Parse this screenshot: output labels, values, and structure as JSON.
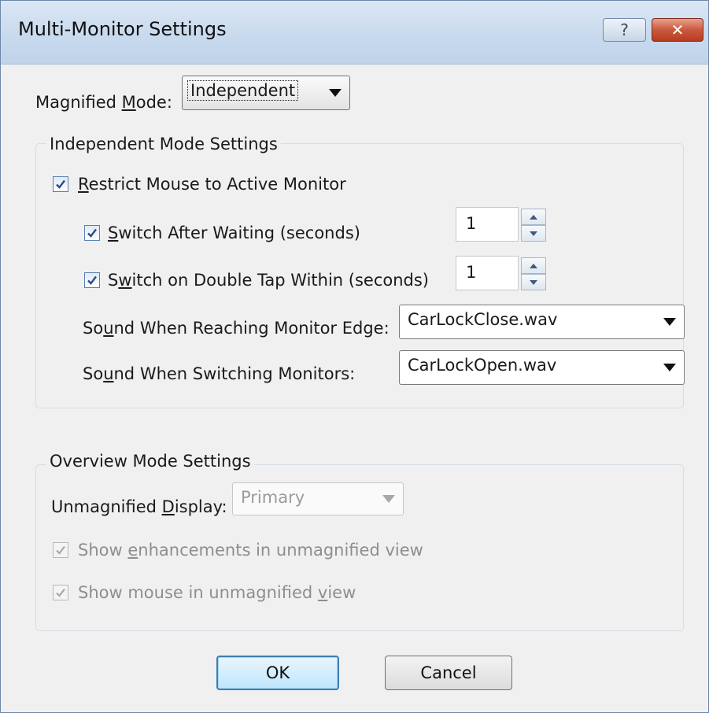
{
  "window": {
    "title": "Multi-Monitor Settings",
    "help_glyph": "?",
    "close_glyph": "✕"
  },
  "magnified_mode": {
    "label_pre": "Magnified ",
    "label_key": "M",
    "label_post": "ode:",
    "value": "Independent"
  },
  "independent": {
    "title": "Independent Mode Settings",
    "restrict_mouse": {
      "key": "R",
      "rest": "estrict Mouse to Active Monitor",
      "checked": true
    },
    "switch_wait": {
      "key": "S",
      "rest": "witch After Waiting (seconds)",
      "checked": true,
      "value": "1"
    },
    "switch_double": {
      "pre": "S",
      "key": "w",
      "rest": "itch on Double Tap Within (seconds)",
      "checked": true,
      "value": "1"
    },
    "sound_edge": {
      "pre": "So",
      "key": "u",
      "rest": "nd When Reaching Monitor Edge:",
      "value": "CarLockClose.wav"
    },
    "sound_switch": {
      "pre": "So",
      "key": "u",
      "rest": "nd When Switching Monitors:",
      "value": "CarLockOpen.wav"
    }
  },
  "overview": {
    "title": "Overview Mode Settings",
    "unmag_display": {
      "pre": "Unmagnified ",
      "key": "D",
      "rest": "isplay:",
      "value": "Primary"
    },
    "show_enh": {
      "pre": "Show ",
      "key": "e",
      "rest": "nhancements in unmagnified view",
      "checked": true
    },
    "show_mouse": {
      "pre": "Show mouse in unmagnified ",
      "key": "v",
      "rest": "iew",
      "checked": true
    }
  },
  "buttons": {
    "ok": "OK",
    "cancel": "Cancel"
  },
  "colors": {
    "accent": "#3c7fb1",
    "close": "#c85a3f",
    "disabled_text": "#8e8e8e"
  }
}
